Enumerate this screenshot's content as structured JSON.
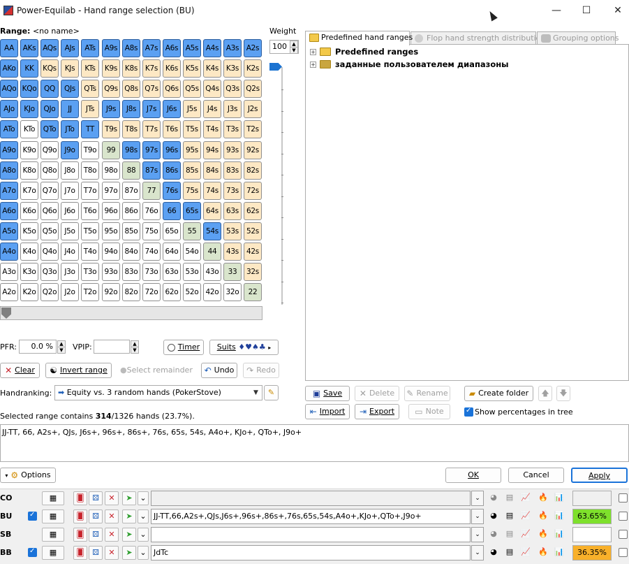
{
  "window": {
    "title": "Power-Equilab - Hand range selection (BU)",
    "minimize": "—",
    "maximize": "☐",
    "close": "✕"
  },
  "range_label": "Range:",
  "range_name": "<no name>",
  "weight_label": "Weight",
  "weight_value": "100",
  "grid": {
    "rows": [
      [
        "AA",
        "AKs",
        "AQs",
        "AJs",
        "ATs",
        "A9s",
        "A8s",
        "A7s",
        "A6s",
        "A5s",
        "A4s",
        "A3s",
        "A2s"
      ],
      [
        "AKo",
        "KK",
        "KQs",
        "KJs",
        "KTs",
        "K9s",
        "K8s",
        "K7s",
        "K6s",
        "K5s",
        "K4s",
        "K3s",
        "K2s"
      ],
      [
        "AQo",
        "KQo",
        "QQ",
        "QJs",
        "QTs",
        "Q9s",
        "Q8s",
        "Q7s",
        "Q6s",
        "Q5s",
        "Q4s",
        "Q3s",
        "Q2s"
      ],
      [
        "AJo",
        "KJo",
        "QJo",
        "JJ",
        "JTs",
        "J9s",
        "J8s",
        "J7s",
        "J6s",
        "J5s",
        "J4s",
        "J3s",
        "J2s"
      ],
      [
        "ATo",
        "KTo",
        "QTo",
        "JTo",
        "TT",
        "T9s",
        "T8s",
        "T7s",
        "T6s",
        "T5s",
        "T4s",
        "T3s",
        "T2s"
      ],
      [
        "A9o",
        "K9o",
        "Q9o",
        "J9o",
        "T9o",
        "99",
        "98s",
        "97s",
        "96s",
        "95s",
        "94s",
        "93s",
        "92s"
      ],
      [
        "A8o",
        "K8o",
        "Q8o",
        "J8o",
        "T8o",
        "98o",
        "88",
        "87s",
        "86s",
        "85s",
        "84s",
        "83s",
        "82s"
      ],
      [
        "A7o",
        "K7o",
        "Q7o",
        "J7o",
        "T7o",
        "97o",
        "87o",
        "77",
        "76s",
        "75s",
        "74s",
        "73s",
        "72s"
      ],
      [
        "A6o",
        "K6o",
        "Q6o",
        "J6o",
        "T6o",
        "96o",
        "86o",
        "76o",
        "66",
        "65s",
        "64s",
        "63s",
        "62s"
      ],
      [
        "A5o",
        "K5o",
        "Q5o",
        "J5o",
        "T5o",
        "95o",
        "85o",
        "75o",
        "65o",
        "55",
        "54s",
        "53s",
        "52s"
      ],
      [
        "A4o",
        "K4o",
        "Q4o",
        "J4o",
        "T4o",
        "94o",
        "84o",
        "74o",
        "64o",
        "54o",
        "44",
        "43s",
        "42s"
      ],
      [
        "A3o",
        "K3o",
        "Q3o",
        "J3o",
        "T3o",
        "93o",
        "83o",
        "73o",
        "63o",
        "53o",
        "43o",
        "33",
        "32s"
      ],
      [
        "A2o",
        "K2o",
        "Q2o",
        "J2o",
        "T2o",
        "92o",
        "82o",
        "72o",
        "62o",
        "52o",
        "42o",
        "32o",
        "22"
      ]
    ],
    "selected": [
      "AA",
      "KK",
      "QQ",
      "JJ",
      "TT",
      "66",
      "AKs",
      "AQs",
      "AJs",
      "ATs",
      "A9s",
      "A8s",
      "A7s",
      "A6s",
      "A5s",
      "A4s",
      "A3s",
      "A2s",
      "QJs",
      "J9s",
      "J8s",
      "J7s",
      "J6s",
      "98s",
      "97s",
      "96s",
      "87s",
      "86s",
      "76s",
      "65s",
      "54s",
      "AKo",
      "AQo",
      "AJo",
      "ATo",
      "A9o",
      "A8o",
      "A7o",
      "A6o",
      "A5o",
      "A4o",
      "KQo",
      "KJo",
      "QJo",
      "QTo",
      "JTo",
      "J9o"
    ]
  },
  "tabs": [
    {
      "label": "Predefined hand ranges",
      "active": true
    },
    {
      "label": "Flop hand strength distribution",
      "active": false
    },
    {
      "label": "Grouping options",
      "active": false
    }
  ],
  "tree": [
    {
      "label": "Predefined ranges",
      "bold": true
    },
    {
      "label": "заданные пользователем диапазоны",
      "bold": true
    }
  ],
  "pfr_label": "PFR:",
  "pfr_value": "0.0 %",
  "vpip_label": "VPIP:",
  "vpip_value": "",
  "timer_label": "Timer",
  "suits_label": "Suits",
  "suits_glyphs": "♦♥♠♣",
  "actions": {
    "clear": "Clear",
    "invert": "Invert range",
    "select_remainder": "Select remainder",
    "undo": "Undo",
    "redo": "Redo"
  },
  "handranking_label": "Handranking:",
  "handranking_value": "Equity vs. 3 random hands (PokerStove)",
  "tree_actions": {
    "save": "Save",
    "delete": "Delete",
    "rename": "Rename",
    "create_folder": "Create folder",
    "import": "Import",
    "export": "Export",
    "note": "Note",
    "show_percentages": "Show percentages in tree"
  },
  "summary_prefix": "Selected range contains ",
  "summary_count": "314",
  "summary_suffix": "/1326 hands (23.7%).",
  "range_text": "JJ-TT, 66, A2s+, QJs, J6s+, 96s+, 86s+, 76s, 65s, 54s, A4o+, KJo+, QTo+, J9o+",
  "options_label": "Options",
  "ok_label": "OK",
  "cancel_label": "Cancel",
  "apply_label": "Apply",
  "players": [
    {
      "name": "CO",
      "checked": false,
      "range": "",
      "equity": "",
      "equity_color": "#f0f0f0"
    },
    {
      "name": "BU",
      "checked": true,
      "range": "JJ-TT,66,A2s+,QJs,J6s+,96s+,86s+,76s,65s,54s,A4o+,KJo+,QTo+,J9o+",
      "equity": "63.65%",
      "equity_color": "#7ee02c"
    },
    {
      "name": "SB",
      "checked": false,
      "range": "",
      "equity": "",
      "equity_color": "#ffffff"
    },
    {
      "name": "BB",
      "checked": true,
      "range": "JdTc",
      "equity": "36.35%",
      "equity_color": "#f8b02a"
    }
  ],
  "colors": {
    "selected": "#5ba0f2",
    "pair": "#d9e5cc",
    "suited": "#fde8c4",
    "offsuit": "#ffffff"
  }
}
